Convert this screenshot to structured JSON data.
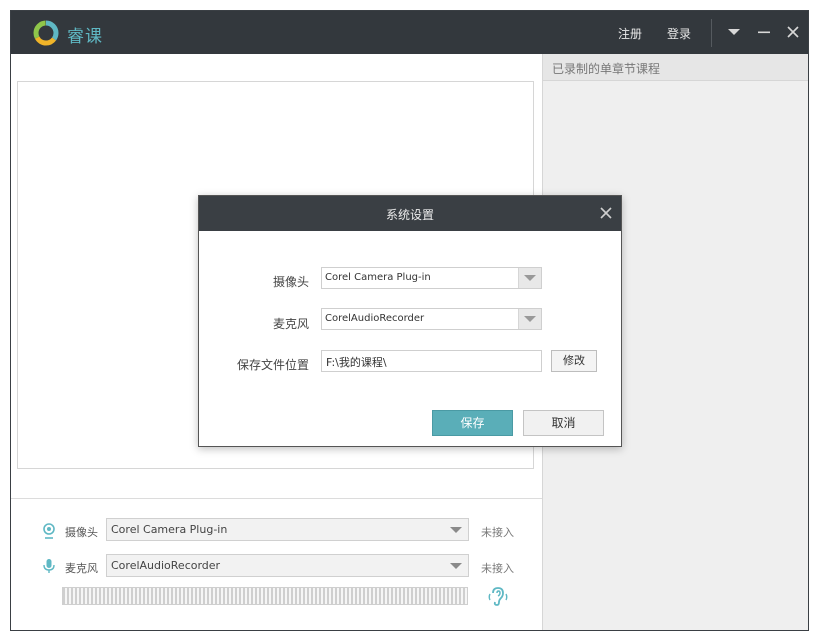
{
  "app": {
    "name": "睿课",
    "register": "注册",
    "login": "登录"
  },
  "right_panel": {
    "title": "已录制的单章节课程"
  },
  "devices": {
    "camera": {
      "label": "摄像头",
      "value": "Corel Camera Plug-in",
      "status": "未接入"
    },
    "mic": {
      "label": "麦克风",
      "value": "CorelAudioRecorder",
      "status": "未接入"
    }
  },
  "dialog": {
    "title": "系统设置",
    "camera_label": "摄像头",
    "camera_value": "Corel Camera Plug-in",
    "mic_label": "麦克风",
    "mic_value": "CorelAudioRecorder",
    "path_label": "保存文件位置",
    "path_value": "F:\\我的课程\\",
    "modify": "修改",
    "save": "保存",
    "cancel": "取消"
  },
  "colors": {
    "accent": "#5fb8c4",
    "titlebar": "#33383d",
    "save_button": "#5aaeb8"
  }
}
